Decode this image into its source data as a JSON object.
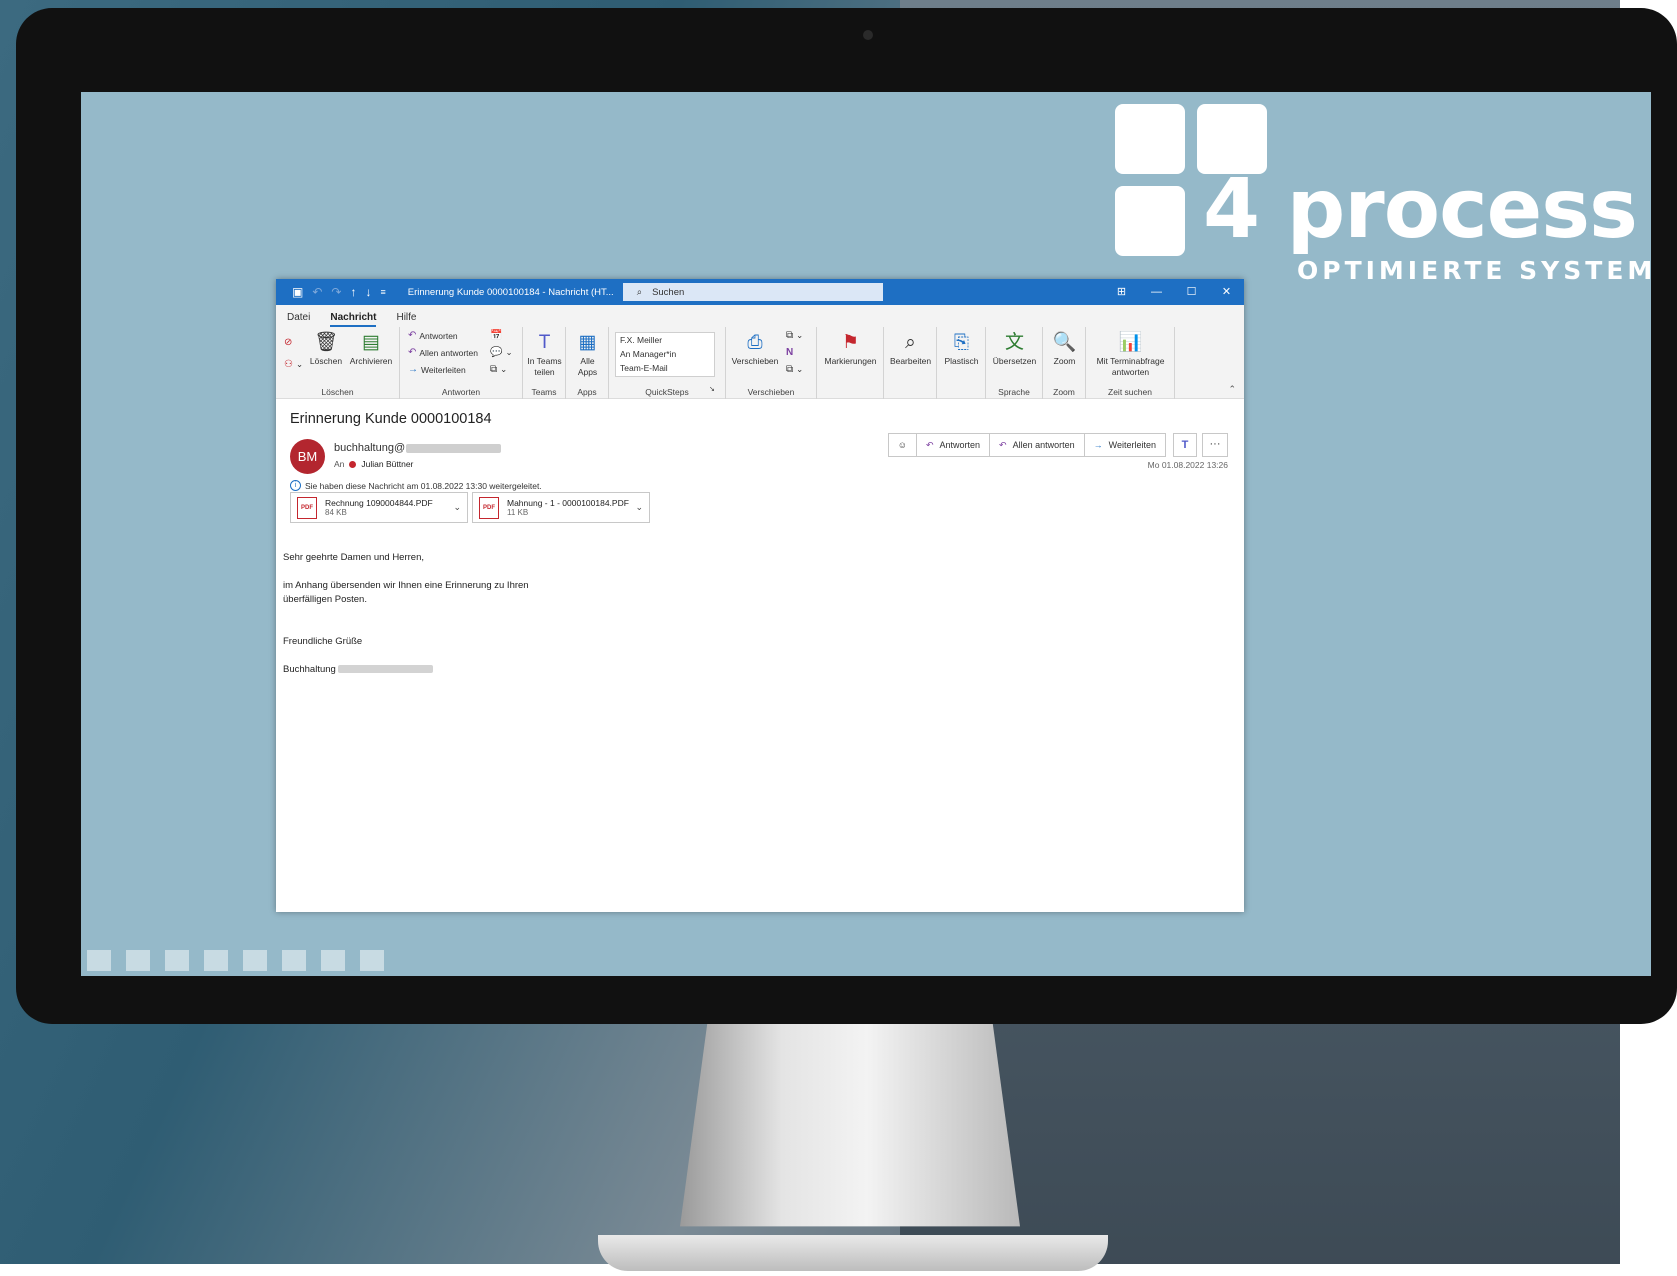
{
  "logo": {
    "word": "4 process",
    "tagline": "OPTIMIERTE SYSTEME"
  },
  "window": {
    "title": "Erinnerung Kunde 0000100184  -  Nachricht (HT...",
    "search_placeholder": "Suchen",
    "accent_color": "#1e6fc3"
  },
  "menu": [
    "Datei",
    "Nachricht",
    "Hilfe"
  ],
  "ribbon": {
    "loeschen": {
      "label": "Löschen",
      "btn_delete": "Löschen",
      "btn_archive": "Archivieren"
    },
    "antworten": {
      "label": "Antworten",
      "reply": "Antworten",
      "reply_all": "Allen antworten",
      "forward": "Weiterleiten"
    },
    "teams": {
      "label": "Teams",
      "btn": "In Teams teilen"
    },
    "apps": {
      "label": "Apps",
      "btn": "Alle Apps"
    },
    "quicksteps": {
      "label": "QuickSteps",
      "items": [
        "F.X. Meiller",
        "An Manager*in",
        "Team-E-Mail"
      ]
    },
    "verschieben": {
      "label": "Verschieben",
      "btn": "Verschieben"
    },
    "markierungen": {
      "btn": "Markierungen"
    },
    "bearbeiten": {
      "btn": "Bearbeiten"
    },
    "plastisch": {
      "btn": "Plastisch"
    },
    "sprache": {
      "label": "Sprache",
      "btn": "Übersetzen"
    },
    "zoom": {
      "label": "Zoom",
      "btn": "Zoom"
    },
    "zeit": {
      "label": "Zeit suchen",
      "btn": "Mit Terminabfrage antworten"
    }
  },
  "message": {
    "subject": "Erinnerung Kunde 0000100184",
    "avatar_initials": "BM",
    "sender_prefix": "buchhaltung@",
    "to_label": "An",
    "to_name": "Julian Büttner",
    "forwarded_info": "Sie haben diese Nachricht am 01.08.2022 13:30 weitergeleitet.",
    "date": "Mo 01.08.2022 13:26",
    "actions": {
      "reply": "Antworten",
      "reply_all": "Allen antworten",
      "forward": "Weiterleiten"
    },
    "attachments": [
      {
        "name": "Rechnung 1090004844.PDF",
        "size": "84 KB"
      },
      {
        "name": "Mahnung - 1 - 0000100184.PDF",
        "size": "11 KB"
      }
    ],
    "body": {
      "greeting": "Sehr geehrte Damen und Herren,",
      "line1": "im Anhang übersenden wir Ihnen eine Erinnerung zu Ihren",
      "line2": "überfälligen Posten.",
      "closing": "Freundliche Grüße",
      "signature_prefix": "Buchhaltung"
    }
  }
}
